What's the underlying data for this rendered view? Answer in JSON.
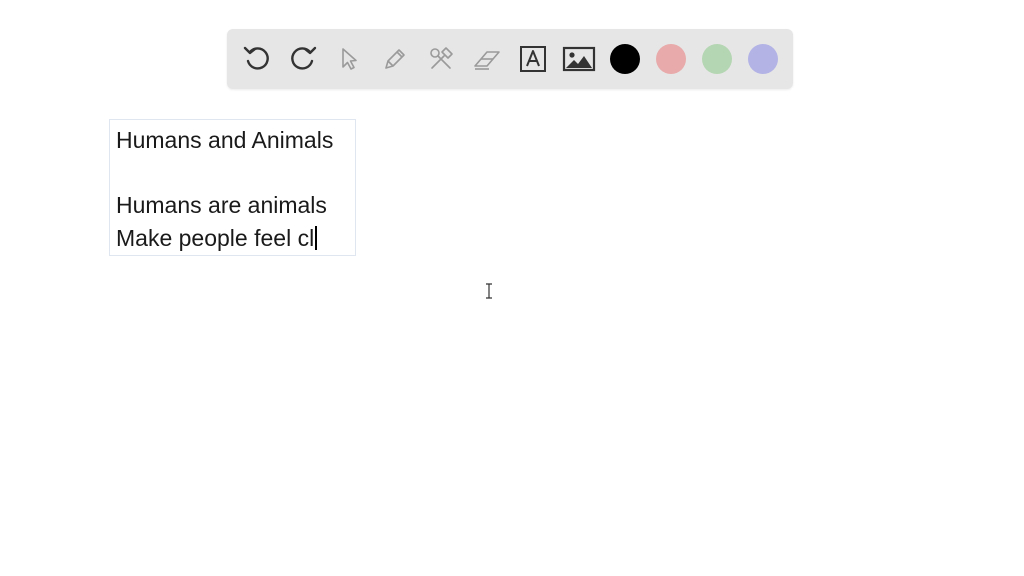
{
  "toolbar": {
    "tools": [
      {
        "icon": "undo-icon"
      },
      {
        "icon": "redo-icon"
      },
      {
        "icon": "select-pointer-icon"
      },
      {
        "icon": "pen-icon"
      },
      {
        "icon": "tools-icon"
      },
      {
        "icon": "eraser-icon"
      },
      {
        "icon": "text-tool-icon",
        "glyph": "A"
      },
      {
        "icon": "image-icon"
      }
    ],
    "colors": [
      "#000000",
      "#e8aaaa",
      "#b5d6b2",
      "#b3b3e6"
    ],
    "selected_color": "#000000"
  },
  "text_box": {
    "lines": [
      "Humans and Animals",
      "",
      "Humans are animals",
      "Make people feel cl"
    ]
  },
  "cursor": "text-ibeam"
}
